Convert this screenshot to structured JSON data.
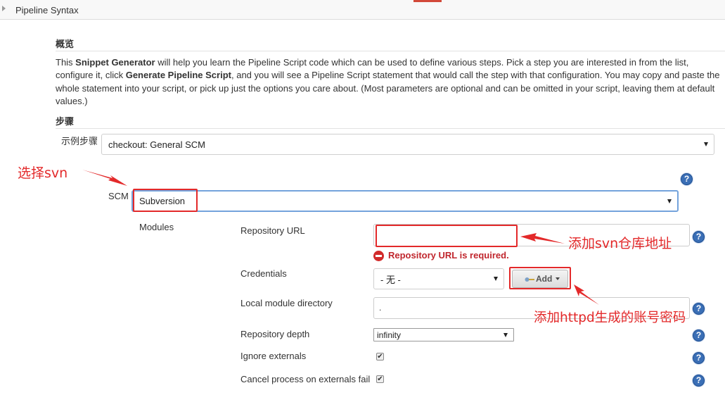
{
  "topbar": {
    "title": "Pipeline Syntax"
  },
  "overview": {
    "heading": "概览",
    "desc_p1": "This ",
    "desc_b1": "Snippet Generator",
    "desc_p2": " will help you learn the Pipeline Script code which can be used to define various steps. Pick a step you are interested in from the list, configure it, click ",
    "desc_b2": "Generate Pipeline Script",
    "desc_p3": ", and you will see a Pipeline Script statement that would call the step with that configuration. You may copy and paste the whole statement into your script, or pick up just the options you care about. (Most parameters are optional and can be omitted in your script, leaving them at default values.)"
  },
  "steps": {
    "heading": "步骤",
    "sample_label": "示例步骤",
    "sample_value": "checkout: General SCM"
  },
  "scm": {
    "label": "SCM",
    "value": "Subversion"
  },
  "modules": {
    "label": "Modules",
    "repo_url_label": "Repository URL",
    "repo_url_value": "",
    "repo_url_error": "Repository URL is required.",
    "credentials_label": "Credentials",
    "credentials_value": "- 无 -",
    "add_button": "Add",
    "local_dir_label": "Local module directory",
    "local_dir_value": ".",
    "depth_label": "Repository depth",
    "depth_value": "infinity",
    "ignore_externals_label": "Ignore externals",
    "ignore_externals_checked": true,
    "cancel_process_label": "Cancel process on externals fail",
    "cancel_process_checked": true
  },
  "help_glyph": "?",
  "check_glyph": "✔",
  "annotations": {
    "choose_svn": "选择svn",
    "add_repo_url": "添加svn仓库地址",
    "add_credentials": "添加httpd生成的账号密码"
  },
  "colors": {
    "annotation_red": "#e3292a",
    "help_blue": "#3b6fb6",
    "error_red": "#c0262d"
  },
  "icons": {
    "help": "help-icon",
    "error": "error-icon",
    "key": "key-icon",
    "checkbox": "checkmark-icon"
  }
}
